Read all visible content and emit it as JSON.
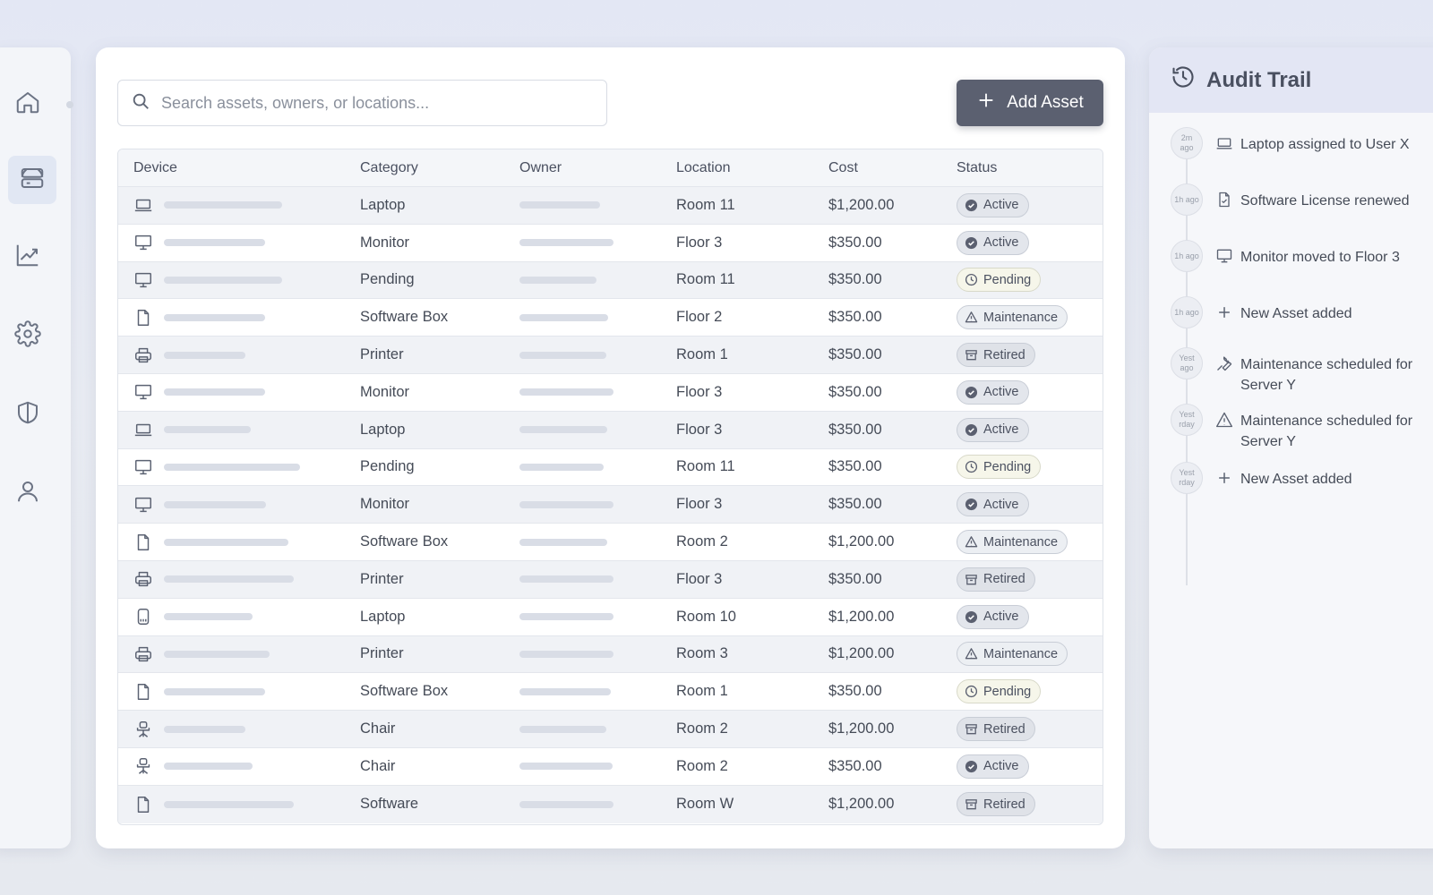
{
  "sidebar": {
    "items": [
      {
        "icon": "home-icon"
      },
      {
        "icon": "server-icon",
        "active": true
      },
      {
        "icon": "chart-icon"
      },
      {
        "icon": "gear-icon"
      },
      {
        "icon": "shield-icon"
      },
      {
        "icon": "user-icon"
      }
    ]
  },
  "search": {
    "placeholder": "Search assets, owners, or locations..."
  },
  "toolbar": {
    "add_label": "Add Asset"
  },
  "table": {
    "headers": {
      "device": "Device",
      "category": "Category",
      "owner": "Owner",
      "location": "Location",
      "cost": "Cost",
      "status": "Status"
    },
    "rows": [
      {
        "icon": "laptop-icon",
        "category": "Laptop",
        "location": "Room 11",
        "cost": "$1,200.00",
        "status": "Active"
      },
      {
        "icon": "monitor-icon",
        "category": "Monitor",
        "location": "Floor 3",
        "cost": "$350.00",
        "status": "Active"
      },
      {
        "icon": "monitor-icon",
        "category": "Pending",
        "location": "Room 11",
        "cost": "$350.00",
        "status": "Pending"
      },
      {
        "icon": "file-icon",
        "category": "Software Box",
        "location": "Floor 2",
        "cost": "$350.00",
        "status": "Maintenance"
      },
      {
        "icon": "printer-icon",
        "category": "Printer",
        "location": "Room 1",
        "cost": "$350.00",
        "status": "Retired"
      },
      {
        "icon": "monitor-icon",
        "category": "Monitor",
        "location": "Floor 3",
        "cost": "$350.00",
        "status": "Active"
      },
      {
        "icon": "laptop-icon",
        "category": "Laptop",
        "location": "Floor 3",
        "cost": "$350.00",
        "status": "Active"
      },
      {
        "icon": "monitor-icon",
        "category": "Pending",
        "location": "Room 11",
        "cost": "$350.00",
        "status": "Pending"
      },
      {
        "icon": "monitor-icon",
        "category": "Monitor",
        "location": "Floor 3",
        "cost": "$350.00",
        "status": "Active"
      },
      {
        "icon": "file-icon",
        "category": "Software Box",
        "location": "Room 2",
        "cost": "$1,200.00",
        "status": "Maintenance"
      },
      {
        "icon": "printer-icon",
        "category": "Printer",
        "location": "Floor 3",
        "cost": "$350.00",
        "status": "Retired"
      },
      {
        "icon": "phone-icon",
        "category": "Laptop",
        "location": "Room 10",
        "cost": "$1,200.00",
        "status": "Active"
      },
      {
        "icon": "printer-icon",
        "category": "Printer",
        "location": "Room 3",
        "cost": "$1,200.00",
        "status": "Maintenance"
      },
      {
        "icon": "file-icon",
        "category": "Software Box",
        "location": "Room 1",
        "cost": "$350.00",
        "status": "Pending"
      },
      {
        "icon": "chair-icon",
        "category": "Chair",
        "location": "Room 2",
        "cost": "$1,200.00",
        "status": "Retired"
      },
      {
        "icon": "chair-icon",
        "category": "Chair",
        "location": "Room 2",
        "cost": "$350.00",
        "status": "Active"
      },
      {
        "icon": "file-icon",
        "category": "Software",
        "location": "Room W",
        "cost": "$1,200.00",
        "status": "Retired"
      }
    ]
  },
  "audit": {
    "title": "Audit Trail",
    "items": [
      {
        "time": "2m ago",
        "icon": "laptop-icon",
        "text": "Laptop assigned to User X"
      },
      {
        "time": "1h ago",
        "icon": "file-check-icon",
        "text": "Software License renewed"
      },
      {
        "time": "1h ago",
        "icon": "monitor-icon",
        "text": "Monitor moved to Floor 3"
      },
      {
        "time": "1h ago",
        "icon": "plus-icon",
        "text": "New Asset added"
      },
      {
        "time": "Yest ago",
        "icon": "wrench-icon",
        "text": "Maintenance scheduled for Server Y"
      },
      {
        "time": "Yest rday",
        "icon": "warning-icon",
        "text": "Maintenance scheduled for Server Y"
      },
      {
        "time": "Yest rday",
        "icon": "plus-icon",
        "text": "New Asset added"
      }
    ]
  }
}
